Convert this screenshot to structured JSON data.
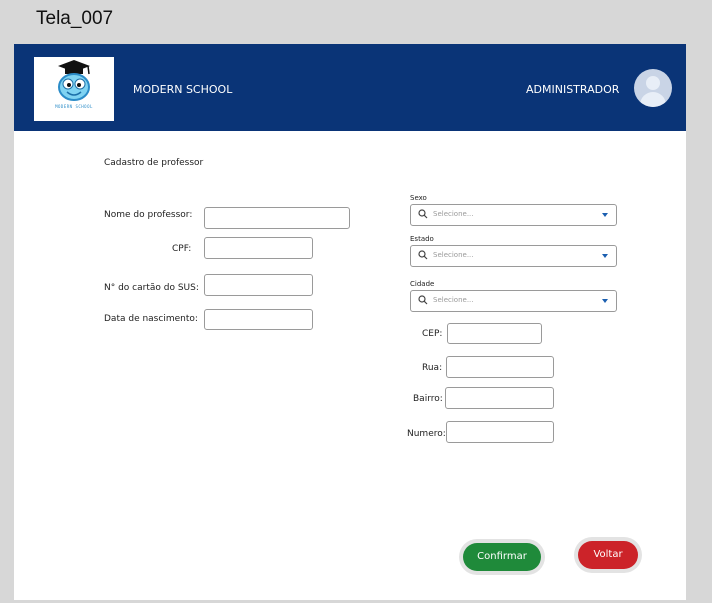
{
  "frame": {
    "title": "Tela_007"
  },
  "header": {
    "logo_text": "MODERN SCHOOL",
    "brand": "MODERN SCHOOL",
    "role": "ADMINISTRADOR"
  },
  "form": {
    "title": "Cadastro de professor",
    "left_fields": [
      {
        "label": "Nome do professor:",
        "value": ""
      },
      {
        "label": "CPF:",
        "value": ""
      },
      {
        "label": "N° do cartão do SUS:",
        "value": ""
      },
      {
        "label": "Data de nascimento:",
        "value": ""
      }
    ],
    "selects": [
      {
        "label": "Sexo",
        "placeholder": "Selecione..."
      },
      {
        "label": "Estado",
        "placeholder": "Selecione..."
      },
      {
        "label": "Cidade",
        "placeholder": "Selecione..."
      }
    ],
    "right_fields": [
      {
        "label": "CEP:",
        "value": ""
      },
      {
        "label": "Rua:",
        "value": ""
      },
      {
        "label": "Bairro:",
        "value": ""
      },
      {
        "label": "Numero:",
        "value": ""
      }
    ]
  },
  "buttons": {
    "confirm": "Confirmar",
    "back": "Voltar"
  },
  "colors": {
    "header": "#0a3477",
    "confirm": "#1f8a3a",
    "back": "#cc2329"
  },
  "icons": [
    "graduation-logo",
    "avatar-icon",
    "search-icon",
    "chevron-down-icon"
  ]
}
